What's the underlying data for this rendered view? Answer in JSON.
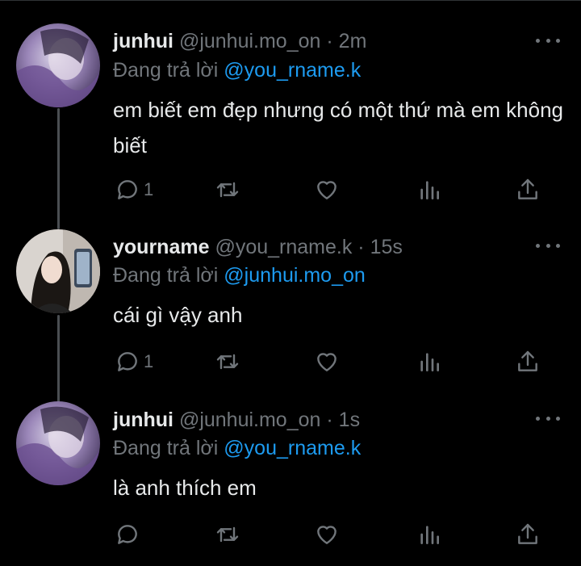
{
  "tweets": [
    {
      "name": "junhui",
      "handle": "@junhui.mo_on",
      "time": "2m",
      "reply_prefix": "Đang trả lời",
      "reply_to": "@you_rname.k",
      "text": "em biết em đẹp nhưng có một thứ mà em không biết",
      "reply_count": "1",
      "avatar": "purple-portrait-avatar"
    },
    {
      "name": "yourname",
      "handle": "@you_rname.k",
      "time": "15s",
      "reply_prefix": "Đang trả lời",
      "reply_to": "@junhui.mo_on",
      "text": "cái gì vậy anh",
      "reply_count": "1",
      "avatar": "selfie-avatar"
    },
    {
      "name": "junhui",
      "handle": "@junhui.mo_on",
      "time": "1s",
      "reply_prefix": "Đang trả lời",
      "reply_to": "@you_rname.k",
      "text": "là anh thích em",
      "reply_count": "",
      "avatar": "purple-portrait-avatar"
    }
  ],
  "separator": "·",
  "icons": {
    "reply": "reply-icon",
    "retweet": "retweet-icon",
    "like": "heart-icon",
    "views": "views-icon",
    "share": "share-icon",
    "more": "more-icon"
  },
  "colors": {
    "background": "#000000",
    "text": "#e7e9ea",
    "muted": "#71767b",
    "mention": "#1d9bf0",
    "thread_line": "#4a4e52"
  }
}
